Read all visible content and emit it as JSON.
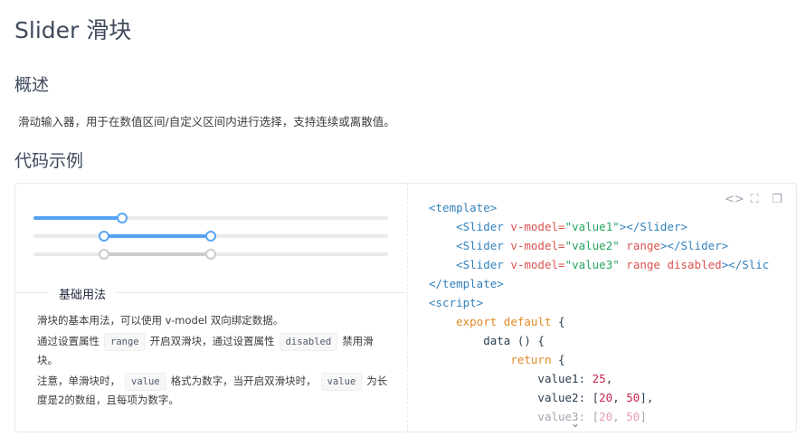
{
  "page": {
    "title": "Slider 滑块",
    "overview_heading": "概述",
    "description": "滑动输入器，用于在数值区间/自定义区间内进行选择，支持连续或离散值。",
    "example_heading": "代码示例"
  },
  "sliders": {
    "s1": {
      "value": 25,
      "min": 0,
      "max": 100
    },
    "s2": {
      "value": [
        20,
        50
      ],
      "min": 0,
      "max": 100,
      "range": true
    },
    "s3": {
      "value": [
        20,
        50
      ],
      "min": 0,
      "max": 100,
      "range": true,
      "disabled": true
    }
  },
  "demo": {
    "title": "基础用法",
    "p1": "滑块的基本用法，可以使用 v-model 双向绑定数据。",
    "p2_a": "通过设置属性",
    "p2_code1": "range",
    "p2_b": "开启双滑块，通过设置属性",
    "p2_code2": "disabled",
    "p2_c": "禁用滑块。",
    "p3_a": "注意，单滑块时，",
    "p3_code1": "value",
    "p3_b": "格式为数字，当开启双滑块时，",
    "p3_code2": "value",
    "p3_c": "为长度是2的数组，且每项为数字。"
  },
  "code": {
    "l1": "<template>",
    "l2_tag": "<Slider",
    "l2_attr": "v-model=",
    "l2_str": "\"value1\"",
    "l2_end": "></Slider>",
    "l3_tag": "<Slider",
    "l3_attr": "v-model=",
    "l3_str": "\"value2\"",
    "l3_attr2": "range",
    "l3_end": "></Slider>",
    "l4_tag": "<Slider",
    "l4_attr": "v-model=",
    "l4_str": "\"value3\"",
    "l4_attr2": "range disabled",
    "l4_end": "></Slic",
    "l5": "</template>",
    "l6": "<script>",
    "l7_kw": "export default",
    "l7_txt": "{",
    "l8": "data () {",
    "l9_kw": "return",
    "l9_txt": "{",
    "l10_txt": "value1:",
    "l10_num": "25",
    "l10_end": ",",
    "l11_txt": "value2: [",
    "l11_n1": "20",
    "l11_sep": ", ",
    "l11_n2": "50",
    "l11_end": "],",
    "l12_txt": "value3: [",
    "l12_n1": "20",
    "l12_sep": ", ",
    "l12_n2": "50",
    "l12_end": "]"
  },
  "icons": {
    "code": "<>",
    "fullscreen": "⛶",
    "copy": "❐",
    "expand": "⌄"
  },
  "colors": {
    "accent": "#57a3f3",
    "disabled": "#cccccc"
  }
}
